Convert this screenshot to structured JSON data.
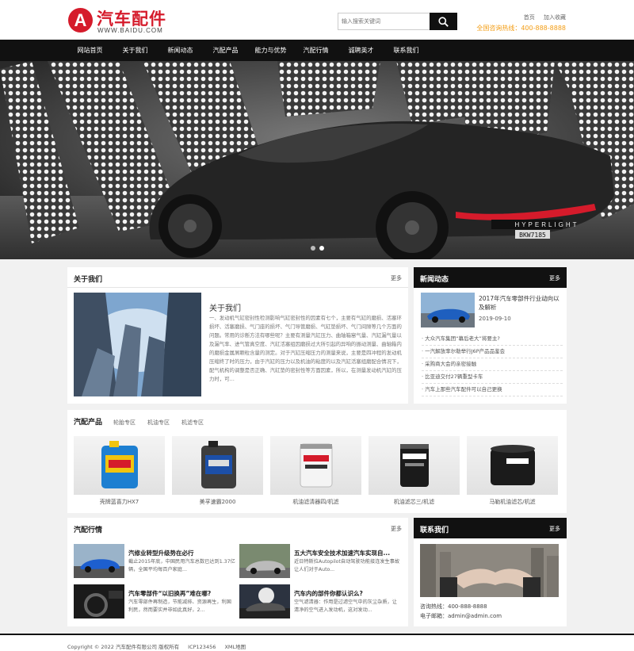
{
  "brand": {
    "logo_letter": "A",
    "name": "汽车配件",
    "domain": "WWW.BAIDU.COM",
    "accent": "#d51b2b"
  },
  "search": {
    "placeholder": "输入搜索关键词"
  },
  "toplinks": {
    "home": "首页",
    "favorite": "加入收藏",
    "hotline": "全国咨询热线：400-888-8888"
  },
  "nav": [
    "网站首页",
    "关于我们",
    "新闻动态",
    "汽配产品",
    "能力与优势",
    "汽配行情",
    "诚聘英才",
    "联系我们"
  ],
  "banner": {
    "slide_count": 2,
    "active_slide": 2,
    "plate": "BKW7185",
    "brand_text": "HYPERLIGHT"
  },
  "about": {
    "heading": "关于我们",
    "more": "更多",
    "title": "关于我们",
    "text": "一、发动机气缸密封性检测影响气缸密封性的因素有七个，主要有气缸的磨损、活塞环损坏、活塞磨损、气门座的损坏、气门导管磨损、气缸垫损坏、气门间隙等几个方面的问题。常用的诊断方法有哪些呢？主要有测量汽缸压力、曲轴箱窜气量、汽缸漏气量以及漏气率、进气管真空度、汽缸活塞组因磨损过大所引起的异响的振动测量、曲轴箱内的磨损金属屑颗粒含量的测定。对于汽缸压缩压力的测量来说，主要是四冲程的发动机压缩终了时的压力，由于汽缸的压力以及机油的粘度的以及汽缸活塞组磨配合情况下，配气机构的调整是否正确、汽缸垫的密封性等方面因素，所以，在测量发动机汽缸的压力时，可…"
  },
  "news": {
    "heading": "新闻动态",
    "more": "更多",
    "featured": {
      "title": "2017年汽车零部件行业动向以及解析",
      "date": "2019-09-10"
    },
    "items": [
      "大众汽车集团“幕后老大”将要主?",
      "一汽解放率尔勒举行J6P产品品鉴会",
      "采购商大会的亲密接触",
      "比亚迪交付27辆重型卡车",
      "汽车上那些汽车配件可以自己更换"
    ]
  },
  "products": {
    "heading": "汽配产品",
    "tabs": [
      "轮胎专区",
      "机油专区",
      "机滤专区"
    ],
    "items": [
      "壳牌蓝喜力HX7",
      "美孚速霸2000",
      "机油滤清器四/机滤",
      "机油滤芯三/机滤",
      "马勒机油滤芯/机滤"
    ]
  },
  "industry": {
    "heading": "汽配行情",
    "more": "更多",
    "items": [
      {
        "title": "汽修业转型升级势在必行",
        "desc": "截止2015年底，中国民用汽车总数已达到1.37亿辆，全国平均每百户家庭..."
      },
      {
        "title": "五大汽车安全技术加速汽车实现自...",
        "desc": "近日特斯拉Autopilot自动驾驶功能接连发生事故 让人们对于Auto..."
      },
      {
        "title": "汽车零部件“以旧换再”难在哪?",
        "desc": "汽车零部件再制造，节能减排、资源再生，利国利民，然而要实并非如此真好，2..."
      },
      {
        "title": "汽车内的部件你都认识么?",
        "desc": "空气滤清器：作用是过滤空气中的灰尘杂质，让清净的空气进入发动机，这对发动..."
      }
    ]
  },
  "contact": {
    "heading": "联系我们",
    "more": "更多",
    "phone": "咨询热线：400-888-8888",
    "email": "电子邮箱：admin@admin.com"
  },
  "footer": {
    "copyright": "Copyright © 2022 汽车配件有限公司 版权所有",
    "icp": "ICP123456",
    "sitemap": "XML地图"
  }
}
